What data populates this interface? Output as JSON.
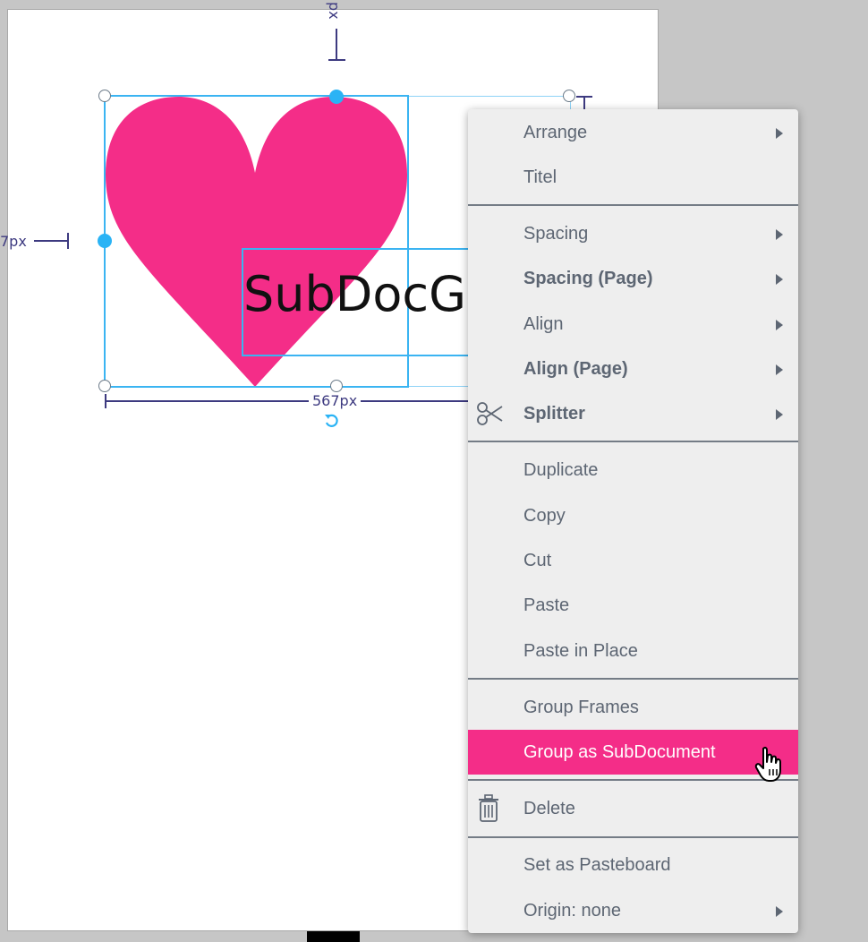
{
  "canvas": {
    "heart_color": "#F42D88",
    "selection_color": "#3AB4F2",
    "frame_text": "SubDocGr",
    "width_label": "567px",
    "left_label": "7px",
    "top_label": "px"
  },
  "context_menu": {
    "highlight_color": "#F42D88",
    "items": [
      {
        "label": "Arrange",
        "submenu": true
      },
      {
        "label": "Titel"
      },
      {
        "label": "Spacing",
        "submenu": true
      },
      {
        "label": "Spacing (Page)",
        "submenu": true,
        "bold": true
      },
      {
        "label": "Align",
        "submenu": true
      },
      {
        "label": "Align (Page)",
        "submenu": true,
        "bold": true
      },
      {
        "label": "Splitter",
        "submenu": true,
        "bold": true,
        "icon": "scissors-icon"
      },
      {
        "label": "Duplicate"
      },
      {
        "label": "Copy"
      },
      {
        "label": "Cut"
      },
      {
        "label": "Paste"
      },
      {
        "label": "Paste in Place"
      },
      {
        "label": "Group Frames"
      },
      {
        "label": "Group as SubDocument",
        "highlighted": true
      },
      {
        "label": "Delete",
        "icon": "trash-icon"
      },
      {
        "label": "Set as Pasteboard"
      },
      {
        "label": "Origin: none",
        "submenu": true
      }
    ]
  }
}
